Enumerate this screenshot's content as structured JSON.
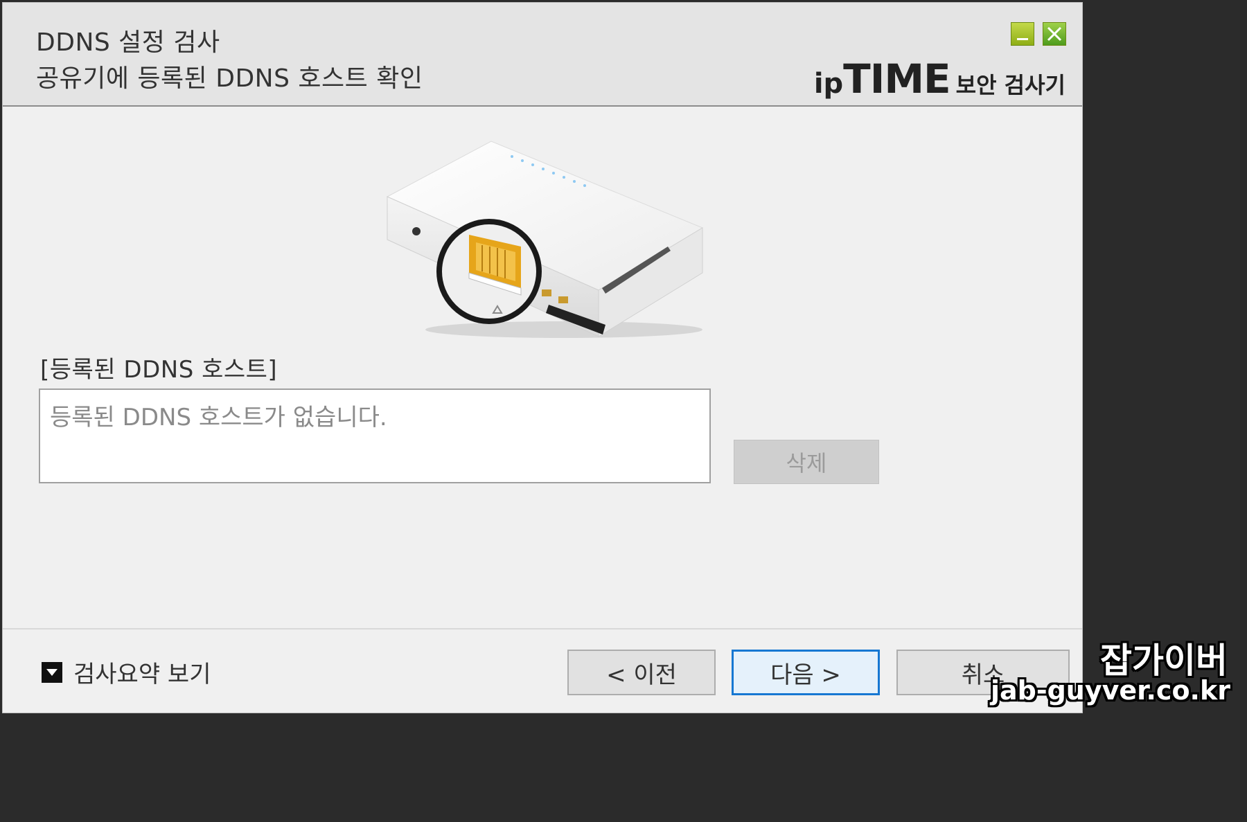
{
  "header": {
    "title": "DDNS 설정 검사",
    "subtitle": "공유기에 등록된 DDNS 호스트 확인",
    "brand_ip": "ip",
    "brand_time": "TIME",
    "brand_suffix": "보안 검사기",
    "window_buttons": {
      "minimize_icon": "minimize-icon",
      "close_icon": "close-icon"
    }
  },
  "hosts": {
    "label": "[등록된 DDNS 호스트]",
    "empty_message": "등록된 DDNS 호스트가 없습니다.",
    "delete_label": "삭제"
  },
  "footer": {
    "summary_label": "검사요약 보기",
    "prev_label": "< 이전",
    "next_label": "다음 >",
    "cancel_label": "취소"
  },
  "watermark": {
    "line1": "잡가이버",
    "line2": "jab-guyver.co.kr"
  },
  "colors": {
    "accent_border": "#1677d2",
    "port_yellow": "#f0b41e",
    "window_bg": "#f0f0f0"
  }
}
